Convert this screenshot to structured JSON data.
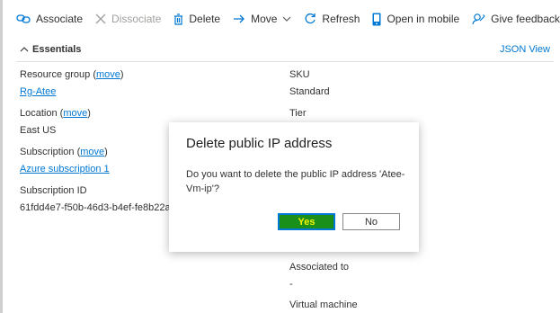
{
  "toolbar": {
    "associate": "Associate",
    "dissociate": "Dissociate",
    "delete": "Delete",
    "move": "Move",
    "refresh": "Refresh",
    "open_mobile": "Open in mobile",
    "feedback": "Give feedback"
  },
  "essentials": {
    "title": "Essentials",
    "json_view": "JSON View",
    "left": {
      "resource_group_label": "Resource group (",
      "move_link": "move",
      "close_paren": ")",
      "resource_group_value": "Rg-Atee",
      "location_label": "Location (",
      "location_value": "East US",
      "subscription_label": "Subscription (",
      "subscription_value": "Azure subscription 1",
      "subscription_id_label": "Subscription ID",
      "subscription_id_value": "61fdd4e7-f50b-46d3-b4ef-fe8b22a"
    },
    "right": {
      "sku_label": "SKU",
      "sku_value": "Standard",
      "tier_label": "Tier",
      "associated_label": "Associated to",
      "associated_value": "-",
      "vm_label": "Virtual machine"
    }
  },
  "dialog": {
    "title": "Delete public IP address",
    "message": "Do you want to delete the public IP address 'Atee-Vm-ip'?",
    "yes": "Yes",
    "no": "No"
  }
}
